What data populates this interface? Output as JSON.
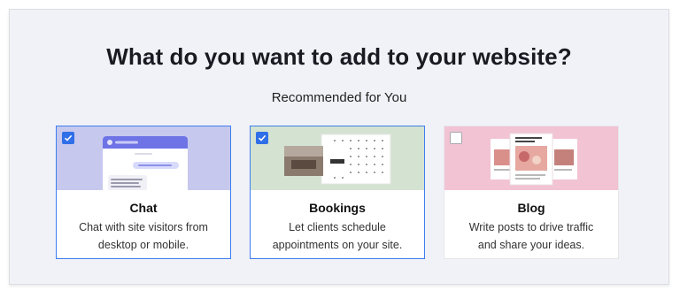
{
  "header": {
    "title": "What do you want to add to your website?",
    "subtitle": "Recommended for You"
  },
  "cards": [
    {
      "name": "Chat",
      "description_line1": "Chat with site visitors from",
      "description_line2": "desktop or mobile.",
      "selected": true,
      "art_bg": "#c6c8ee"
    },
    {
      "name": "Bookings",
      "description_line1": "Let clients schedule",
      "description_line2": "appointments on your site.",
      "selected": true,
      "art_bg": "#d4e3d1"
    },
    {
      "name": "Blog",
      "description_line1": "Write posts to drive traffic",
      "description_line2": "and share your ideas.",
      "selected": false,
      "art_bg": "#f2c3d3"
    }
  ],
  "colors": {
    "accent": "#3d7ef0",
    "panel_bg": "#f1f2f7"
  }
}
